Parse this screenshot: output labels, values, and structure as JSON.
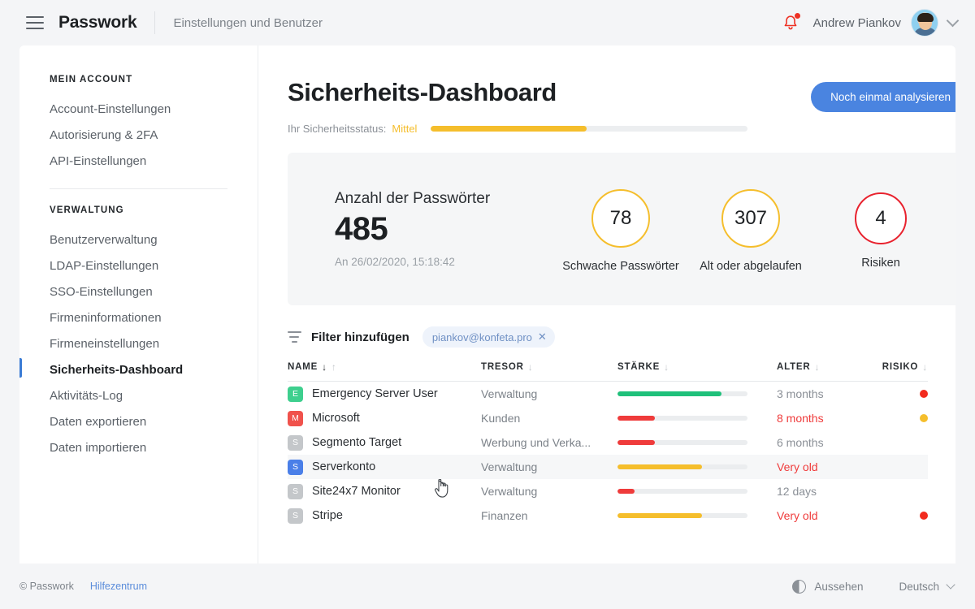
{
  "topbar": {
    "menu_icon": "hamburger-icon",
    "brand": "Passwork",
    "subtitle": "Einstellungen und Benutzer",
    "notification_icon": "bell-icon",
    "username": "Andrew Piankov",
    "avatar": "user-avatar",
    "chevron_icon": "chevron-down-icon"
  },
  "sidebar": {
    "groups": [
      {
        "heading": "MEIN ACCOUNT",
        "items": [
          {
            "label": "Account-Einstellungen",
            "active": false
          },
          {
            "label": "Autorisierung & 2FA",
            "active": false
          },
          {
            "label": "API-Einstellungen",
            "active": false
          }
        ]
      },
      {
        "heading": "VERWALTUNG",
        "items": [
          {
            "label": "Benutzerverwaltung",
            "active": false
          },
          {
            "label": "LDAP-Einstellungen",
            "active": false
          },
          {
            "label": "SSO-Einstellungen",
            "active": false
          },
          {
            "label": "Firmeninformationen",
            "active": false
          },
          {
            "label": "Firmeneinstellungen",
            "active": false
          },
          {
            "label": "Sicherheits-Dashboard",
            "active": true
          },
          {
            "label": "Aktivitäts-Log",
            "active": false
          },
          {
            "label": "Daten exportieren",
            "active": false
          },
          {
            "label": "Daten importieren",
            "active": false
          }
        ]
      }
    ]
  },
  "main": {
    "title": "Sicherheits-Dashboard",
    "analyze_button": "Noch einmal analysieren",
    "status": {
      "label": "Ihr Sicherheitsstatus:",
      "value": "Mittel",
      "percent": 49,
      "color": "#f5be2c"
    },
    "stats": {
      "count_label": "Anzahl der Passwörter",
      "count_value": "485",
      "count_date": "An 26/02/2020, 15:18:42",
      "donuts": [
        {
          "value": "78",
          "caption": "Schwache Passwörter",
          "color": "#f5be2c"
        },
        {
          "value": "307",
          "caption": "Alt oder abgelaufen",
          "color": "#f5be2c"
        },
        {
          "value": "4",
          "caption": "Risiken",
          "color": "#e8222e"
        }
      ]
    },
    "filter": {
      "icon": "filter-icon",
      "label": "Filter hinzufügen",
      "chips": [
        {
          "text": "piankov@konfeta.pro",
          "remove_icon": "close-icon"
        }
      ]
    },
    "table": {
      "columns": [
        {
          "label": "NAME",
          "sort": "both"
        },
        {
          "label": "TRESOR",
          "sort": "down"
        },
        {
          "label": "STÄRKE",
          "sort": "down"
        },
        {
          "label": "ALTER",
          "sort": "down"
        },
        {
          "label": "RISIKO",
          "sort": "down"
        }
      ],
      "rows": [
        {
          "badge": "E",
          "badge_color": "#3ecf8e",
          "name": "Emergency Server User",
          "vault": "Verwaltung",
          "strength": 80,
          "strength_color": "#1fc07a",
          "age": "3 months",
          "age_warn": false,
          "risk_color": "#f22b1e"
        },
        {
          "badge": "M",
          "badge_color": "#f0524c",
          "name": "Microsoft",
          "vault": "Kunden",
          "strength": 29,
          "strength_color": "#ef3b3b",
          "age": "8 months",
          "age_warn": true,
          "risk_color": "#f5be2c"
        },
        {
          "badge": "S",
          "badge_color": "#c4c7ca",
          "name": "Segmento Target",
          "vault": "Werbung und Verka...",
          "strength": 29,
          "strength_color": "#ef3b3b",
          "age": "6 months",
          "age_warn": false,
          "risk_color": ""
        },
        {
          "badge": "S",
          "badge_color": "#4a7fe8",
          "name": "Serverkonto",
          "vault": "Verwaltung",
          "strength": 65,
          "strength_color": "#f5be2c",
          "age": "Very old",
          "age_warn": true,
          "risk_color": "",
          "selected": true
        },
        {
          "badge": "S",
          "badge_color": "#c4c7ca",
          "name": "Site24x7 Monitor",
          "vault": "Verwaltung",
          "strength": 13,
          "strength_color": "#ef3b3b",
          "age": "12 days",
          "age_warn": false,
          "risk_color": ""
        },
        {
          "badge": "S",
          "badge_color": "#c4c7ca",
          "name": "Stripe",
          "vault": "Finanzen",
          "strength": 65,
          "strength_color": "#f5be2c",
          "age": "Very old",
          "age_warn": true,
          "risk_color": "#f22b1e"
        }
      ]
    }
  },
  "footer": {
    "copyright": "© Passwork",
    "help": "Hilfezentrum",
    "theme_icon": "half-circle-icon",
    "theme_label": "Aussehen",
    "language": "Deutsch",
    "language_chevron": "chevron-down-icon"
  }
}
